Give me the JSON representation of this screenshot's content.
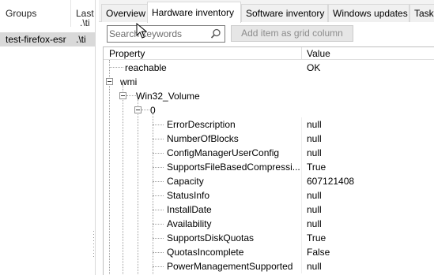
{
  "left_pane": {
    "columns": [
      "Groups",
      "Last"
    ],
    "col_last_second_line": ".\\ti",
    "groups": [
      {
        "name": "test-firefox-esr",
        "last": ".\\ti"
      }
    ]
  },
  "tabs": [
    {
      "label": "Overview",
      "active": false
    },
    {
      "label": "Hardware inventory",
      "active": true
    },
    {
      "label": "Software inventory",
      "active": false
    },
    {
      "label": "Windows updates",
      "active": false
    },
    {
      "label": "Task",
      "active": false
    }
  ],
  "toolbar": {
    "search_placeholder": "Search keywords",
    "add_button_label": "Add item as grid column"
  },
  "grid": {
    "headers": {
      "property": "Property",
      "value": "Value"
    },
    "rows": [
      {
        "name": "reachable",
        "value": "OK"
      },
      {
        "name": "wmi",
        "value": ""
      },
      {
        "name": "Win32_Volume",
        "value": ""
      },
      {
        "name": "0",
        "value": ""
      },
      {
        "name": "ErrorDescription",
        "value": "null"
      },
      {
        "name": "NumberOfBlocks",
        "value": "null"
      },
      {
        "name": "ConfigManagerUserConfig",
        "value": "null"
      },
      {
        "name": "SupportsFileBasedCompressi...",
        "value": "True"
      },
      {
        "name": "Capacity",
        "value": "607121408"
      },
      {
        "name": "StatusInfo",
        "value": "null"
      },
      {
        "name": "InstallDate",
        "value": "null"
      },
      {
        "name": "Availability",
        "value": "null"
      },
      {
        "name": "SupportsDiskQuotas",
        "value": "True"
      },
      {
        "name": "QuotasIncomplete",
        "value": "False"
      },
      {
        "name": "PowerManagementSupported",
        "value": "null"
      }
    ]
  },
  "colors": {
    "selection": "#d9d9d9",
    "border": "#d9d9d9",
    "disabled_text": "#8c8c8c"
  },
  "icons": {
    "search": "magnifier-icon",
    "expander": "minus-box-icon",
    "cursor": "mouse-pointer-icon"
  }
}
